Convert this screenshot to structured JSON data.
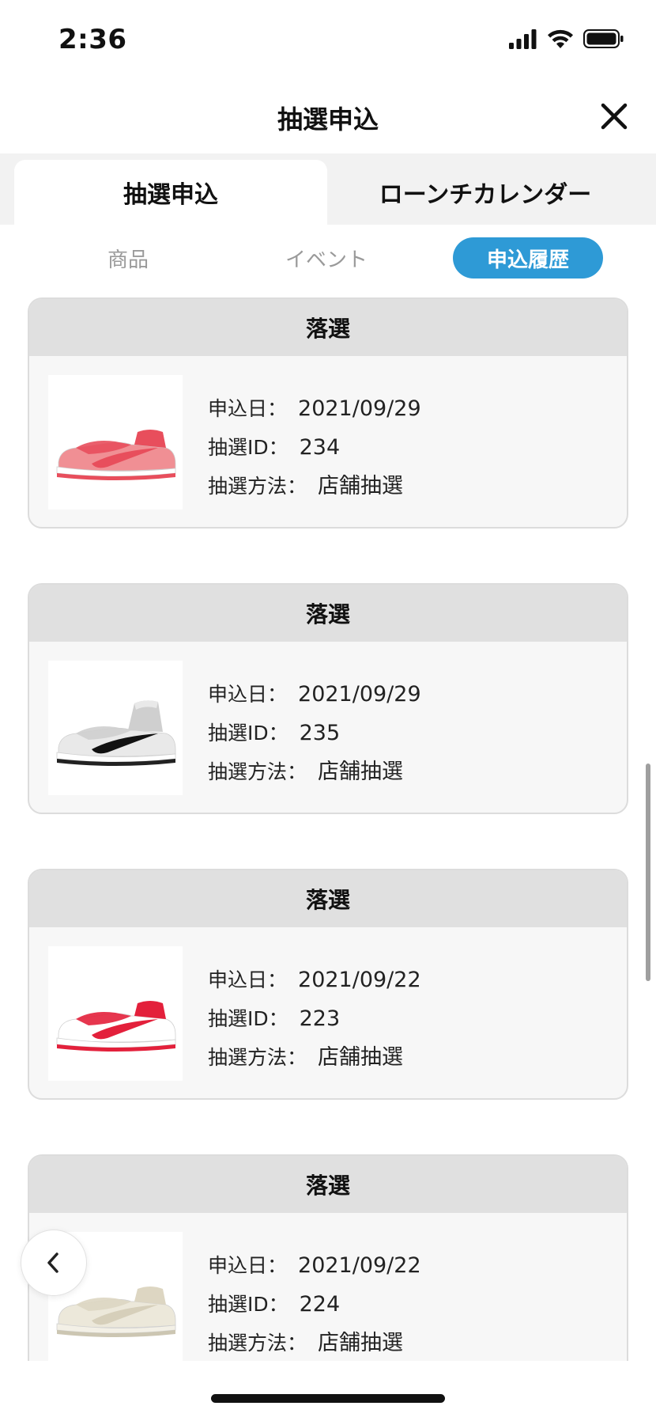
{
  "status_bar": {
    "time": "2:36",
    "icons": [
      "signal-icon",
      "wifi-icon",
      "battery-icon"
    ]
  },
  "header": {
    "title": "抽選申込",
    "close_icon": "close-icon"
  },
  "top_tabs": [
    {
      "label": "抽選申込",
      "active": true
    },
    {
      "label": "ローンチカレンダー",
      "active": false
    }
  ],
  "sub_tabs": [
    {
      "label": "商品",
      "active": false
    },
    {
      "label": "イベント",
      "active": false
    },
    {
      "label": "申込履歴",
      "active": true
    }
  ],
  "labels": {
    "date": "申込日：",
    "lottery_id": "抽選ID：",
    "method": "抽選方法："
  },
  "entries": [
    {
      "status": "落選",
      "date": "2021/09/29",
      "lottery_id": "234",
      "method": "店舗抽選",
      "shoe": {
        "upper": "#f08f94",
        "accent": "#e84e5c",
        "swoosh": "#e84e5c",
        "sole": "#e84e5c",
        "base": "#ffffff"
      }
    },
    {
      "status": "落選",
      "date": "2021/09/29",
      "lottery_id": "235",
      "method": "店舗抽選",
      "shoe": {
        "upper": "#e9e9e9",
        "accent": "#cfcfcf",
        "swoosh": "#111111",
        "sole": "#222222",
        "base": "#ffffff"
      }
    },
    {
      "status": "落選",
      "date": "2021/09/22",
      "lottery_id": "223",
      "method": "店舗抽選",
      "shoe": {
        "upper": "#ffffff",
        "accent": "#e3203b",
        "swoosh": "#e3203b",
        "sole": "#e3203b",
        "base": "#ffffff"
      }
    },
    {
      "status": "落選",
      "date": "2021/09/22",
      "lottery_id": "224",
      "method": "店舗抽選",
      "shoe": {
        "upper": "#ece8da",
        "accent": "#ddd6c2",
        "swoosh": "#d6cfba",
        "sole": "#ccc6b2",
        "base": "#f3f0e6"
      }
    }
  ],
  "colors": {
    "accent": "#2e9ad6",
    "card_header": "#e0e0e0",
    "card_bg": "#f7f7f7"
  },
  "back_button_icon": "chevron-left-icon"
}
